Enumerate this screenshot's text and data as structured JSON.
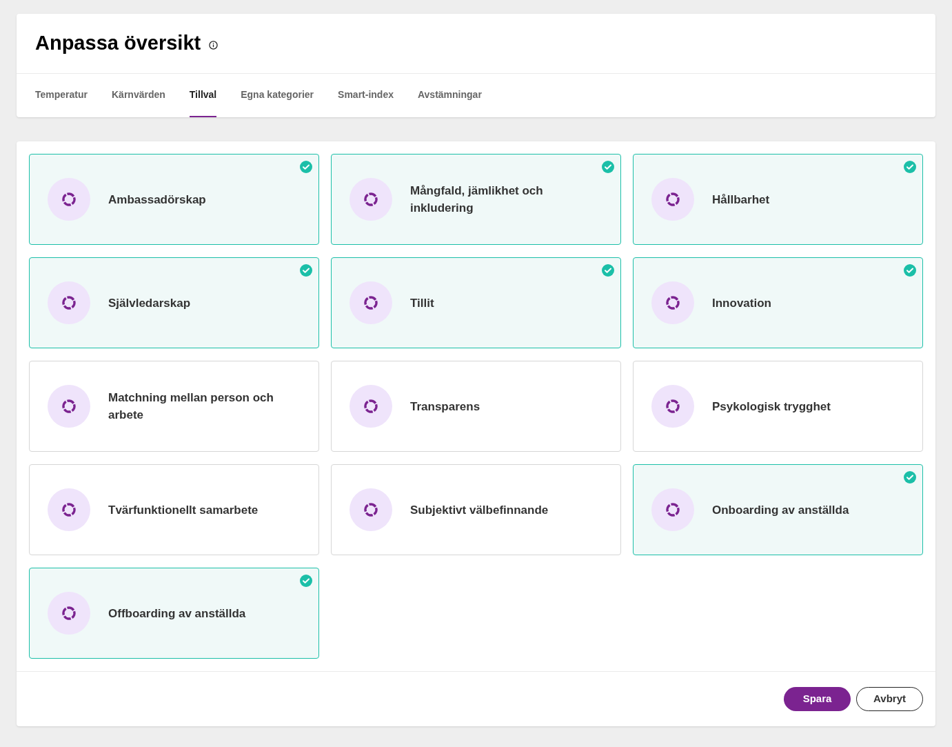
{
  "title": "Anpassa översikt",
  "tabs": [
    {
      "label": "Temperatur",
      "selected": false
    },
    {
      "label": "Kärnvärden",
      "selected": false
    },
    {
      "label": "Tillval",
      "selected": true
    },
    {
      "label": "Egna kategorier",
      "selected": false
    },
    {
      "label": "Smart-index",
      "selected": false
    },
    {
      "label": "Avstämningar",
      "selected": false
    }
  ],
  "options": [
    {
      "label": "Ambassadörskap",
      "selected": true
    },
    {
      "label": "Mångfald, jämlikhet och inkludering",
      "selected": true
    },
    {
      "label": "Hållbarhet",
      "selected": true
    },
    {
      "label": "Självledarskap",
      "selected": true
    },
    {
      "label": "Tillit",
      "selected": true
    },
    {
      "label": "Innovation",
      "selected": true
    },
    {
      "label": "Matchning mellan person och arbete",
      "selected": false
    },
    {
      "label": "Transparens",
      "selected": false
    },
    {
      "label": "Psykologisk trygghet",
      "selected": false
    },
    {
      "label": "Tvärfunktionellt samarbete",
      "selected": false
    },
    {
      "label": "Subjektivt välbefinnande",
      "selected": false
    },
    {
      "label": "Onboarding av anställda",
      "selected": true
    },
    {
      "label": "Offboarding av anställda",
      "selected": true
    }
  ],
  "buttons": {
    "save": "Spara",
    "cancel": "Avbryt"
  }
}
